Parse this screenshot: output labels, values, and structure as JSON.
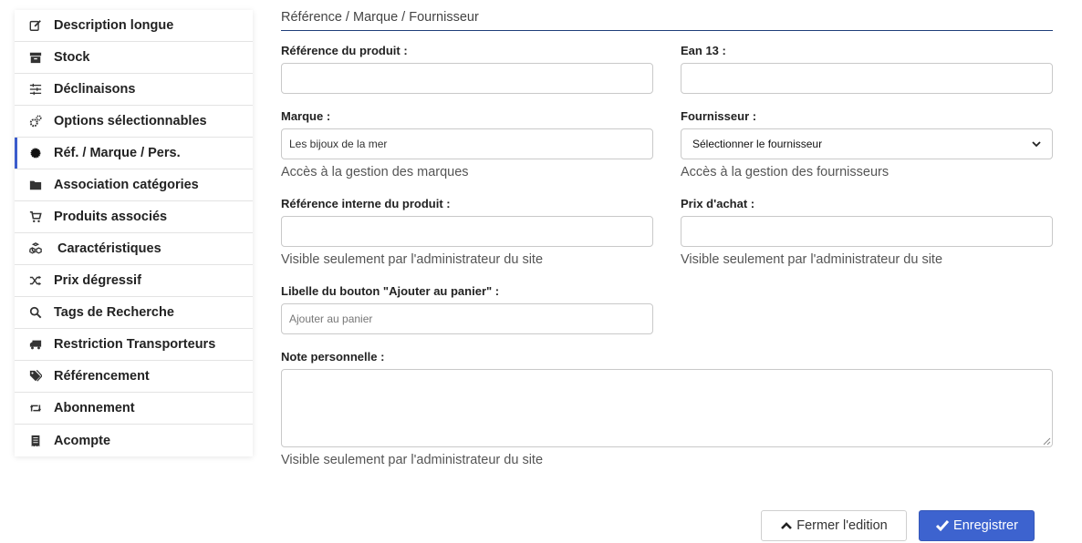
{
  "sidebar": {
    "items": [
      {
        "label": "Description longue",
        "icon": "edit-icon"
      },
      {
        "label": "Stock",
        "icon": "archive-box-icon"
      },
      {
        "label": "Déclinaisons",
        "icon": "sliders-icon"
      },
      {
        "label": "Options sélectionnables",
        "icon": "cogs-icon"
      },
      {
        "label": "Réf. / Marque / Pers.",
        "icon": "circle-icon"
      },
      {
        "label": "Association catégories",
        "icon": "folder-icon"
      },
      {
        "label": "Produits associés",
        "icon": "cart-icon"
      },
      {
        "label": "Caractéristiques",
        "icon": "cubes-icon"
      },
      {
        "label": "Prix dégressif",
        "icon": "shuffle-icon"
      },
      {
        "label": "Tags de Recherche",
        "icon": "search-icon"
      },
      {
        "label": "Restriction Transporteurs",
        "icon": "truck-icon"
      },
      {
        "label": "Référencement",
        "icon": "tags-icon"
      },
      {
        "label": "Abonnement",
        "icon": "retweet-icon"
      },
      {
        "label": "Acompte",
        "icon": "receipt-icon"
      }
    ],
    "active_index": 4
  },
  "section": {
    "title": "Référence / Marque / Fournisseur"
  },
  "form": {
    "ref_label": "Référence du produit :",
    "ref_value": "",
    "ean_label": "Ean 13 :",
    "ean_value": "",
    "brand_label": "Marque :",
    "brand_value": "Les bijoux de la mer",
    "brand_help": "Accès à la gestion des marques",
    "supplier_label": "Fournisseur :",
    "supplier_selected": "Sélectionner le fournisseur",
    "supplier_help": "Accès à la gestion des fournisseurs",
    "internal_ref_label": "Référence interne du produit :",
    "internal_ref_value": "",
    "internal_ref_help": "Visible seulement par l'administrateur du site",
    "price_label": "Prix d'achat :",
    "price_value": "",
    "price_help": "Visible seulement par l'administrateur du site",
    "cart_btn_label": "Libelle du bouton \"Ajouter au panier\" :",
    "cart_btn_placeholder": "Ajouter au panier",
    "note_label": "Note personnelle :",
    "note_value": "",
    "note_help": "Visible seulement par l'administrateur du site"
  },
  "actions": {
    "close_label": "Fermer l'edition",
    "save_label": "Enregistrer"
  },
  "colors": {
    "accent": "#3d63cf",
    "section_rule": "#1f3f7a"
  }
}
